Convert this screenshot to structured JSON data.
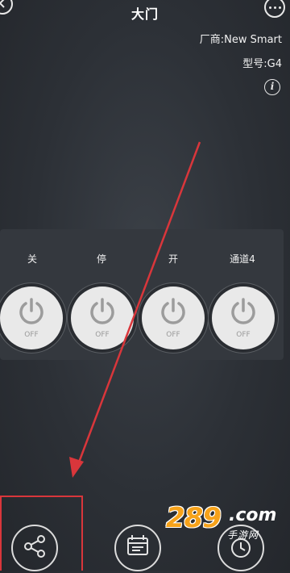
{
  "header": {
    "title": "大门",
    "vendor": "厂商:New Smart",
    "model": "型号:G4"
  },
  "channels": [
    {
      "label": "关",
      "state": "OFF"
    },
    {
      "label": "停",
      "state": "OFF"
    },
    {
      "label": "开",
      "state": "OFF"
    },
    {
      "label": "通道4",
      "state": "OFF"
    }
  ],
  "watermark": {
    "number": "289",
    "domain": ".com",
    "sub": "手游网"
  },
  "colors": {
    "background": "#2c3036",
    "power_button": "#e9e9e9",
    "annotation": "#d9363b",
    "watermark_orange": "#f6a21a"
  },
  "icons": [
    "back-icon",
    "more-icon",
    "info-icon",
    "power-icon",
    "share-icon",
    "calendar-icon",
    "clock-icon"
  ]
}
